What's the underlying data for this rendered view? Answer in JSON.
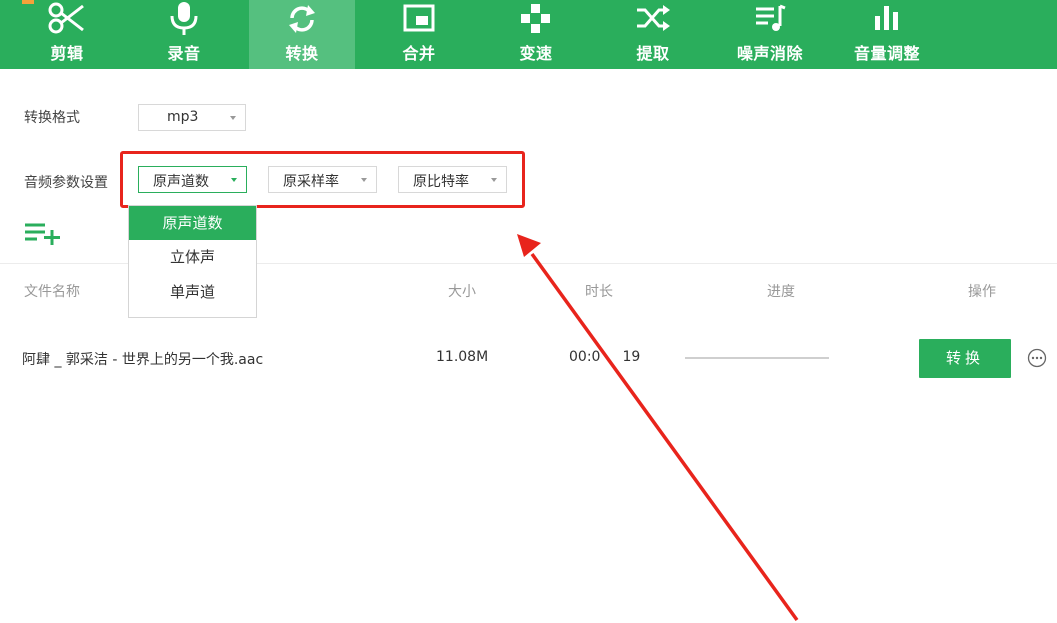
{
  "toolbar": {
    "tools": [
      {
        "label": "剪辑",
        "icon": "scissors-icon"
      },
      {
        "label": "录音",
        "icon": "microphone-icon"
      },
      {
        "label": "转换",
        "icon": "convert-icon",
        "active": true
      },
      {
        "label": "合并",
        "icon": "merge-icon"
      },
      {
        "label": "变速",
        "icon": "speed-icon"
      },
      {
        "label": "提取",
        "icon": "shuffle-icon"
      },
      {
        "label": "噪声消除",
        "icon": "noise-icon"
      },
      {
        "label": "音量调整",
        "icon": "volume-bars-icon"
      }
    ]
  },
  "settings": {
    "format_label": "转换格式",
    "format_value": "mp3",
    "params_label": "音频参数设置",
    "channels_value": "原声道数",
    "samplerate_value": "原采样率",
    "bitrate_value": "原比特率"
  },
  "channels_dropdown": {
    "options": [
      "原声道数",
      "立体声",
      "单声道"
    ],
    "selected_index": 0
  },
  "table": {
    "headers": {
      "name": "文件名称",
      "size": "大小",
      "duration": "时长",
      "progress": "进度",
      "action": "操作"
    },
    "rows": [
      {
        "name": "阿肆 _ 郭采洁 - 世界上的另一个我.aac",
        "size": "11.08M",
        "duration": "00:0",
        "duration_tail": "19",
        "progress": 0,
        "button": "转换"
      }
    ]
  },
  "colors": {
    "brand": "#2aae5c",
    "annotation": "#e8241c"
  }
}
